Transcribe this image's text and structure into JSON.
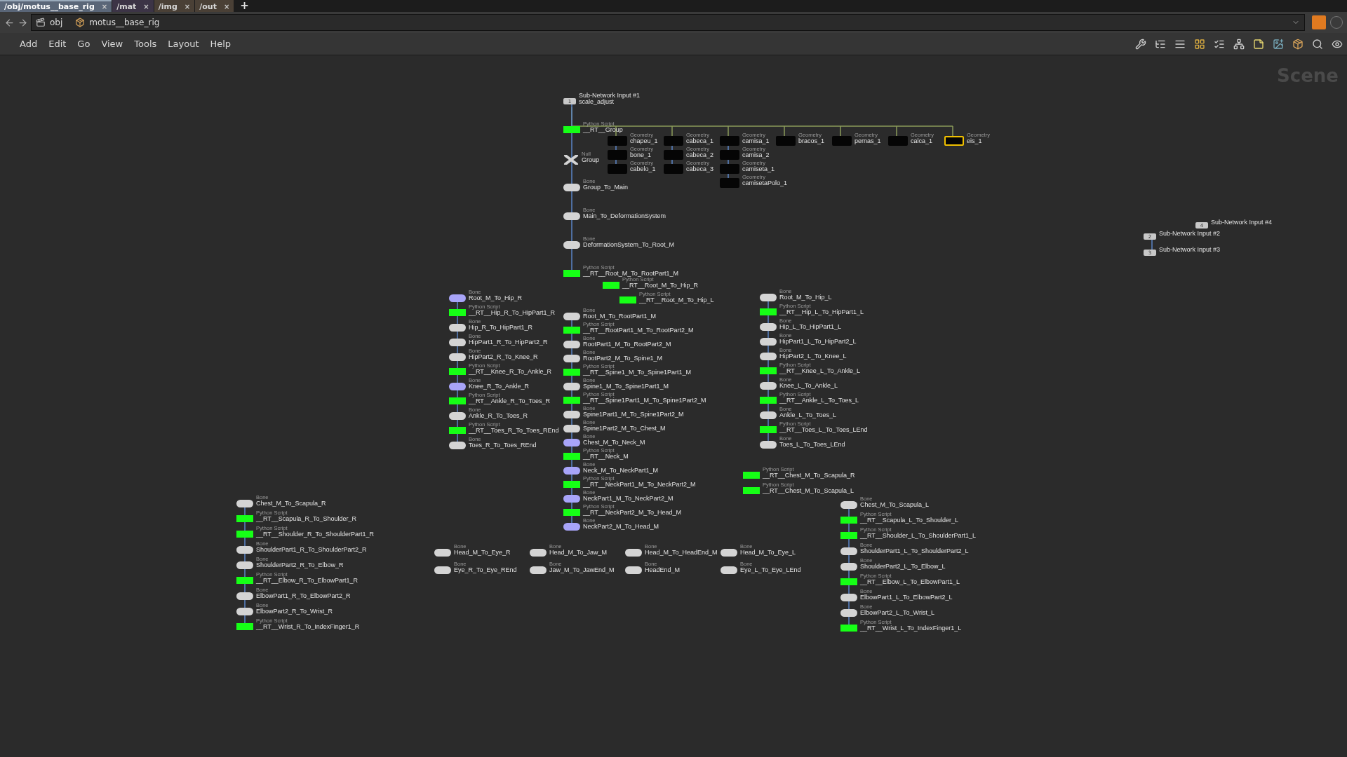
{
  "tabs": [
    {
      "label": "/obj/motus__base_rig",
      "close": "×",
      "selected": true,
      "color": "#5a6678"
    },
    {
      "label": "/mat",
      "close": "×",
      "selected": false,
      "color": "#3c3446"
    },
    {
      "label": "/img",
      "close": "×",
      "selected": false,
      "color": "#4a4036"
    },
    {
      "label": "/out",
      "close": "×",
      "selected": false,
      "color": "#4a4036"
    }
  ],
  "new_tab": "+",
  "path": [
    "obj",
    "motus__base_rig"
  ],
  "menu": [
    "Add",
    "Edit",
    "Go",
    "View",
    "Tools",
    "Layout",
    "Help"
  ],
  "canvas_title": "Scene",
  "chains": [
    {
      "nodes": [
        {
          "kind": "input",
          "number": "1",
          "name": "Sub-Network Input #1",
          "subtitle": "scale_adjust"
        },
        {
          "kind": "script",
          "type": "Python Script",
          "name": "__RT__Group"
        },
        {
          "kind": "null",
          "type": "Null",
          "name": "Group"
        },
        {
          "kind": "bone",
          "type": "Bone",
          "name": "Group_To_Main",
          "highlighted": false
        },
        {
          "kind": "bone",
          "type": "Bone",
          "name": "Main_To_DeformationSystem",
          "highlighted": false
        },
        {
          "kind": "bone",
          "type": "Bone",
          "name": "DeformationSystem_To_Root_M",
          "highlighted": false
        },
        {
          "kind": "script",
          "type": "Python Script",
          "name": "__RT__Root_M_To_RootPart1_M"
        }
      ]
    },
    {
      "nodes": [
        {
          "kind": "geometry",
          "type": "Geometry",
          "name": "chapeu_1",
          "selected": false
        },
        {
          "kind": "geometry",
          "type": "Geometry",
          "name": "bone_1",
          "selected": false
        },
        {
          "kind": "geometry",
          "type": "Geometry",
          "name": "cabelo_1",
          "selected": false
        }
      ]
    },
    {
      "nodes": [
        {
          "kind": "geometry",
          "type": "Geometry",
          "name": "cabeca_1",
          "selected": false
        },
        {
          "kind": "geometry",
          "type": "Geometry",
          "name": "cabeca_2",
          "selected": false
        },
        {
          "kind": "geometry",
          "type": "Geometry",
          "name": "cabeca_3",
          "selected": false
        }
      ]
    },
    {
      "nodes": [
        {
          "kind": "geometry",
          "type": "Geometry",
          "name": "camisa_1",
          "selected": false
        },
        {
          "kind": "geometry",
          "type": "Geometry",
          "name": "camisa_2",
          "selected": false
        },
        {
          "kind": "geometry",
          "type": "Geometry",
          "name": "camiseta_1",
          "selected": false
        },
        {
          "kind": "geometry",
          "type": "Geometry",
          "name": "camisetaPolo_1",
          "selected": false
        }
      ]
    },
    {
      "nodes": [
        {
          "kind": "geometry",
          "type": "Geometry",
          "name": "bracos_1",
          "selected": false
        }
      ]
    },
    {
      "nodes": [
        {
          "kind": "geometry",
          "type": "Geometry",
          "name": "pernas_1",
          "selected": false
        }
      ]
    },
    {
      "nodes": [
        {
          "kind": "geometry",
          "type": "Geometry",
          "name": "calca_1",
          "selected": false
        }
      ]
    },
    {
      "nodes": [
        {
          "kind": "geometry",
          "type": "Geometry",
          "name": "eis_1",
          "selected": true
        }
      ]
    },
    {
      "nodes": [
        {
          "kind": "input",
          "number": "4",
          "name": "Sub-Network Input #4"
        }
      ]
    },
    {
      "nodes": [
        {
          "kind": "input",
          "number": "2",
          "name": "Sub-Network Input #2"
        },
        {
          "kind": "input",
          "number": "3",
          "name": "Sub-Network Input #3"
        }
      ]
    },
    {
      "nodes": [
        {
          "kind": "script",
          "type": "Python Script",
          "name": "__RT__Root_M_To_Hip_R"
        }
      ]
    },
    {
      "nodes": [
        {
          "kind": "bone",
          "type": "Bone",
          "name": "Root_M_To_Hip_R",
          "highlighted": true
        },
        {
          "kind": "script",
          "type": "Python Script",
          "name": "__RT__Hip_R_To_HipPart1_R"
        },
        {
          "kind": "bone",
          "type": "Bone",
          "name": "Hip_R_To_HipPart1_R",
          "highlighted": false
        },
        {
          "kind": "bone",
          "type": "Bone",
          "name": "HipPart1_R_To_HipPart2_R",
          "highlighted": false
        },
        {
          "kind": "bone",
          "type": "Bone",
          "name": "HipPart2_R_To_Knee_R",
          "highlighted": false
        },
        {
          "kind": "script",
          "type": "Python Script",
          "name": "__RT__Knee_R_To_Ankle_R"
        },
        {
          "kind": "bone",
          "type": "Bone",
          "name": "Knee_R_To_Ankle_R",
          "highlighted": true
        },
        {
          "kind": "script",
          "type": "Python Script",
          "name": "__RT__Ankle_R_To_Toes_R"
        },
        {
          "kind": "bone",
          "type": "Bone",
          "name": "Ankle_R_To_Toes_R",
          "highlighted": false
        },
        {
          "kind": "script",
          "type": "Python Script",
          "name": "__RT__Toes_R_To_Toes_REnd"
        },
        {
          "kind": "bone",
          "type": "Bone",
          "name": "Toes_R_To_Toes_REnd",
          "highlighted": false
        }
      ]
    },
    {
      "nodes": [
        {
          "kind": "script",
          "type": "Python Script",
          "name": "__RT__Root_M_To_Hip_L"
        }
      ]
    },
    {
      "nodes": [
        {
          "kind": "bone",
          "type": "Bone",
          "name": "Root_M_To_Hip_L",
          "highlighted": false
        },
        {
          "kind": "script",
          "type": "Python Script",
          "name": "__RT__Hip_L_To_HipPart1_L"
        },
        {
          "kind": "bone",
          "type": "Bone",
          "name": "Hip_L_To_HipPart1_L",
          "highlighted": false
        },
        {
          "kind": "bone",
          "type": "Bone",
          "name": "HipPart1_L_To_HipPart2_L",
          "highlighted": false
        },
        {
          "kind": "bone",
          "type": "Bone",
          "name": "HipPart2_L_To_Knee_L",
          "highlighted": false
        },
        {
          "kind": "script",
          "type": "Python Script",
          "name": "__RT__Knee_L_To_Ankle_L"
        },
        {
          "kind": "bone",
          "type": "Bone",
          "name": "Knee_L_To_Ankle_L",
          "highlighted": false
        },
        {
          "kind": "script",
          "type": "Python Script",
          "name": "__RT__Ankle_L_To_Toes_L"
        },
        {
          "kind": "bone",
          "type": "Bone",
          "name": "Ankle_L_To_Toes_L",
          "highlighted": false
        },
        {
          "kind": "script",
          "type": "Python Script",
          "name": "__RT__Toes_L_To_Toes_LEnd"
        },
        {
          "kind": "bone",
          "type": "Bone",
          "name": "Toes_L_To_Toes_LEnd",
          "highlighted": false
        }
      ]
    },
    {
      "nodes": [
        {
          "kind": "bone",
          "type": "Bone",
          "name": "Root_M_To_RootPart1_M",
          "highlighted": false
        },
        {
          "kind": "script",
          "type": "Python Script",
          "name": "__RT__RootPart1_M_To_RootPart2_M"
        },
        {
          "kind": "bone",
          "type": "Bone",
          "name": "RootPart1_M_To_RootPart2_M",
          "highlighted": false
        },
        {
          "kind": "bone",
          "type": "Bone",
          "name": "RootPart2_M_To_Spine1_M",
          "highlighted": false
        },
        {
          "kind": "script",
          "type": "Python Script",
          "name": "__RT__Spine1_M_To_Spine1Part1_M"
        },
        {
          "kind": "bone",
          "type": "Bone",
          "name": "Spine1_M_To_Spine1Part1_M",
          "highlighted": false
        },
        {
          "kind": "script",
          "type": "Python Script",
          "name": "__RT__Spine1Part1_M_To_Spine1Part2_M"
        },
        {
          "kind": "bone",
          "type": "Bone",
          "name": "Spine1Part1_M_To_Spine1Part2_M",
          "highlighted": false
        },
        {
          "kind": "bone",
          "type": "Bone",
          "name": "Spine1Part2_M_To_Chest_M",
          "highlighted": false
        },
        {
          "kind": "bone",
          "type": "Bone",
          "name": "Chest_M_To_Neck_M",
          "highlighted": true
        },
        {
          "kind": "script",
          "type": "Python Script",
          "name": "__RT__Neck_M"
        },
        {
          "kind": "bone",
          "type": "Bone",
          "name": "Neck_M_To_NeckPart1_M",
          "highlighted": true
        },
        {
          "kind": "script",
          "type": "Python Script",
          "name": "__RT__NeckPart1_M_To_NeckPart2_M"
        },
        {
          "kind": "bone",
          "type": "Bone",
          "name": "NeckPart1_M_To_NeckPart2_M",
          "highlighted": true
        },
        {
          "kind": "script",
          "type": "Python Script",
          "name": "__RT__NeckPart2_M_To_Head_M"
        },
        {
          "kind": "bone",
          "type": "Bone",
          "name": "NeckPart2_M_To_Head_M",
          "highlighted": true
        }
      ]
    },
    {
      "nodes": [
        {
          "kind": "script",
          "type": "Python Script",
          "name": "__RT__Chest_M_To_Scapula_R"
        }
      ]
    },
    {
      "nodes": [
        {
          "kind": "script",
          "type": "Python Script",
          "name": "__RT__Chest_M_To_Scapula_L"
        }
      ]
    },
    {
      "nodes": [
        {
          "kind": "bone",
          "type": "Bone",
          "name": "Chest_M_To_Scapula_R",
          "highlighted": false
        },
        {
          "kind": "script",
          "type": "Python Script",
          "name": "__RT__Scapula_R_To_Shoulder_R"
        },
        {
          "kind": "script",
          "type": "Python Script",
          "name": "__RT__Shoulder_R_To_ShoulderPart1_R"
        },
        {
          "kind": "bone",
          "type": "Bone",
          "name": "ShoulderPart1_R_To_ShoulderPart2_R",
          "highlighted": false
        },
        {
          "kind": "bone",
          "type": "Bone",
          "name": "ShoulderPart2_R_To_Elbow_R",
          "highlighted": false
        },
        {
          "kind": "script",
          "type": "Python Script",
          "name": "__RT__Elbow_R_To_ElbowPart1_R"
        },
        {
          "kind": "bone",
          "type": "Bone",
          "name": "ElbowPart1_R_To_ElbowPart2_R",
          "highlighted": false
        },
        {
          "kind": "bone",
          "type": "Bone",
          "name": "ElbowPart2_R_To_Wrist_R",
          "highlighted": false
        },
        {
          "kind": "script",
          "type": "Python Script",
          "name": "__RT__Wrist_R_To_IndexFinger1_R"
        }
      ]
    },
    {
      "nodes": [
        {
          "kind": "bone",
          "type": "Bone",
          "name": "Chest_M_To_Scapula_L",
          "highlighted": false
        },
        {
          "kind": "script",
          "type": "Python Script",
          "name": "__RT__Scapula_L_To_Shoulder_L"
        },
        {
          "kind": "script",
          "type": "Python Script",
          "name": "__RT__Shoulder_L_To_ShoulderPart1_L"
        },
        {
          "kind": "bone",
          "type": "Bone",
          "name": "ShoulderPart1_L_To_ShoulderPart2_L",
          "highlighted": false
        },
        {
          "kind": "bone",
          "type": "Bone",
          "name": "ShoulderPart2_L_To_Elbow_L",
          "highlighted": false
        },
        {
          "kind": "script",
          "type": "Python Script",
          "name": "__RT__Elbow_L_To_ElbowPart1_L"
        },
        {
          "kind": "bone",
          "type": "Bone",
          "name": "ElbowPart1_L_To_ElbowPart2_L",
          "highlighted": false
        },
        {
          "kind": "bone",
          "type": "Bone",
          "name": "ElbowPart2_L_To_Wrist_L",
          "highlighted": false
        },
        {
          "kind": "script",
          "type": "Python Script",
          "name": "__RT__Wrist_L_To_IndexFinger1_L"
        }
      ]
    },
    {
      "nodes": [
        {
          "kind": "bone",
          "type": "Bone",
          "name": "Head_M_To_Eye_R",
          "highlighted": false
        },
        {
          "kind": "bone",
          "type": "Bone",
          "name": "Head_M_To_Jaw_M",
          "highlighted": false
        },
        {
          "kind": "bone",
          "type": "Bone",
          "name": "Head_M_To_HeadEnd_M",
          "highlighted": false
        },
        {
          "kind": "bone",
          "type": "Bone",
          "name": "Head_M_To_Eye_L",
          "highlighted": false
        }
      ]
    },
    {
      "nodes": [
        {
          "kind": "bone",
          "type": "Bone",
          "name": "Eye_R_To_Eye_REnd",
          "highlighted": false
        },
        {
          "kind": "bone",
          "type": "Bone",
          "name": "Jaw_M_To_JawEnd_M",
          "highlighted": false
        },
        {
          "kind": "bone",
          "type": "Bone",
          "name": "HeadEnd_M",
          "highlighted": false
        },
        {
          "kind": "bone",
          "type": "Bone",
          "name": "Eye_L_To_Eye_LEnd",
          "highlighted": false
        }
      ]
    }
  ]
}
